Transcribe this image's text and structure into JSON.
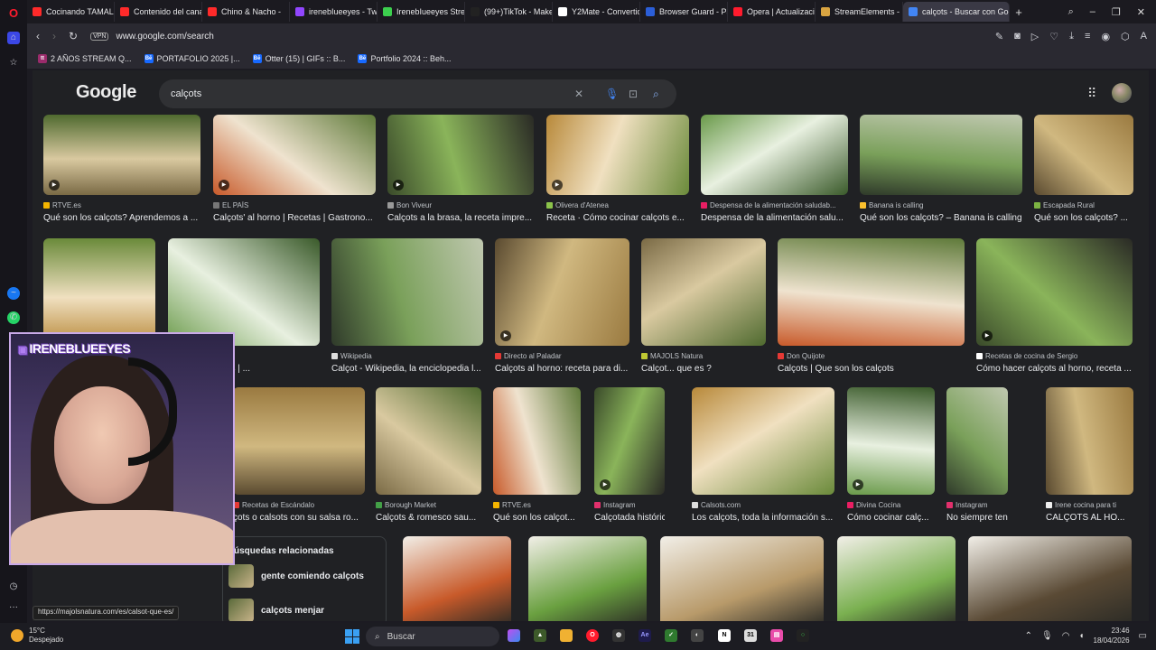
{
  "browser": {
    "tabs": [
      {
        "label": "Cocinando TAMAL PE",
        "color": "#ff2a2a"
      },
      {
        "label": "Contenido del canal",
        "color": "#ff2a2a"
      },
      {
        "label": "Chino & Nacho -",
        "color": "#ff2a2a"
      },
      {
        "label": "irenebIueeyes - Twitc",
        "color": "#9146ff"
      },
      {
        "label": "IrenebIueeyes Stream",
        "color": "#3ccf4e"
      },
      {
        "label": "(99+)TikTok - Make Y",
        "color": "#222222"
      },
      {
        "label": "Y2Mate - Convertido",
        "color": "#ffffff"
      },
      {
        "label": "Browser Guard - Pág",
        "color": "#2b5ed8"
      },
      {
        "label": "Opera | Actualizació",
        "color": "#ff1b2d"
      },
      {
        "label": "StreamElements - Mu",
        "color": "#d9a441"
      },
      {
        "label": "calçots - Buscar con Goog",
        "color": "#4285f4",
        "active": true
      }
    ],
    "url": "www.google.com/search",
    "vpn": "VPN",
    "bookmarks": [
      {
        "label": "2 AÑOS STREAM Q...",
        "color": "#9a2b6b",
        "icon": "tt"
      },
      {
        "label": "PORTAFOLIO 2025 |...",
        "color": "#1769ff",
        "icon": "Bē"
      },
      {
        "label": "Otter (15) | GIFs :: B...",
        "color": "#1769ff",
        "icon": "Bē"
      },
      {
        "label": "Portfolio 2024 :: Beh...",
        "color": "#1769ff",
        "icon": "Bē"
      }
    ]
  },
  "google": {
    "logo": "Google",
    "query": "calçots",
    "rows": [
      [
        {
          "source": "RTVE.es",
          "title": "Qué son los calçots? Aprendemos a ...",
          "fav": "#f4b400",
          "video": true
        },
        {
          "source": "EL PAÍS",
          "title": "Calçots' al horno | Recetas | Gastrono...",
          "fav": "#777777",
          "video": true
        },
        {
          "source": "Bon Viveur",
          "title": "Calçots a la brasa, la receta impre...",
          "fav": "#999999",
          "video": true
        },
        {
          "source": "Olivera d'Atenea",
          "title": "Receta · Cómo cocinar calçots e...",
          "fav": "#8bc34a",
          "video": true
        },
        {
          "source": "Despensa de la alimentación saludab...",
          "title": "Despensa de la alimentación salu...",
          "fav": "#e91e63",
          "video": false
        },
        {
          "source": "Banana is calling",
          "title": "Qué son los calçots? – Banana is calling",
          "fav": "#fbc02d",
          "video": false
        },
        {
          "source": "Escapada Rural",
          "title": "Qué son los calçots? ...",
          "fav": "#7cb342",
          "video": false
        }
      ],
      [
        {
          "source": "",
          "title": "",
          "fav": "#999999",
          "video": false
        },
        {
          "source": "",
          "title": "echar los calçots | ...",
          "fav": "#999999",
          "video": false
        },
        {
          "source": "Wikipedia",
          "title": "Calçot - Wikipedia, la enciclopedia l...",
          "fav": "#dddddd",
          "video": false
        },
        {
          "source": "Directo al Paladar",
          "title": "Calçots al horno: receta para di...",
          "fav": "#e53935",
          "video": true
        },
        {
          "source": "MAJOLS Natura",
          "title": "Calçot... que es ?",
          "fav": "#c0ca33",
          "video": false
        },
        {
          "source": "Don Quijote",
          "title": "Calçots | Que son los calçots",
          "fav": "#e53935",
          "video": false
        },
        {
          "source": "Recetas de cocina de Sergio",
          "title": "Cómo hacer calçots al horno, receta ...",
          "fav": "#ffffff",
          "video": true
        }
      ],
      [
        {
          "source": "Recetas de Escándalo",
          "title": "çots o calsots con su salsa ro...",
          "fav": "#e53935",
          "video": false
        },
        {
          "source": "Borough Market",
          "title": "Calçots & romesco sau...",
          "fav": "#43a047",
          "video": false
        },
        {
          "source": "RTVE.es",
          "title": "Qué son los calçot...",
          "fav": "#f4b400",
          "video": false
        },
        {
          "source": "Instagram",
          "title": "Calçotada histórica...",
          "fav": "#e1306c",
          "video": true
        },
        {
          "source": "Calsots.com",
          "title": "Los calçots, toda la información s...",
          "fav": "#dddddd",
          "video": false
        },
        {
          "source": "Divina Cocina",
          "title": "Cómo cocinar calç...",
          "fav": "#e91e63",
          "video": true
        },
        {
          "source": "Instagram",
          "title": "No siempre tenem...",
          "fav": "#e1306c",
          "video": false
        },
        {
          "source": "Irene cocina para ti",
          "title": "CALÇOTS AL HO...",
          "fav": "#eeeeee",
          "video": false
        }
      ]
    ],
    "related": {
      "heading": "úsquedas relacionadas",
      "items": [
        "gente comiendo calçots",
        "calçots menjar"
      ]
    }
  },
  "stream": {
    "overlay_name": "IRENEBLUEEYES"
  },
  "status_url": "https://majolsnatura.com/es/calsot-que-es/",
  "taskbar": {
    "temperature": "15°C",
    "weather": "Despejado",
    "search_label": "Buscar",
    "time": "23:46",
    "date": "18/04/2026"
  }
}
